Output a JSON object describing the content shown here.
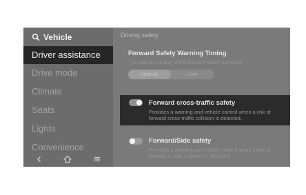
{
  "sidebar": {
    "header": "Vehicle",
    "items": [
      {
        "label": "Driver assistance"
      },
      {
        "label": "Drive mode"
      },
      {
        "label": "Climate"
      },
      {
        "label": "Seats"
      },
      {
        "label": "Lights"
      },
      {
        "label": "Convenience"
      }
    ],
    "nav_icons": [
      "back-icon",
      "home-icon",
      "menu-icon"
    ]
  },
  "main": {
    "section_title": "Driving safety",
    "warning_timing": {
      "title": "Forward Safety Warning Timing",
      "description": "The warning timing of the forward safety functions",
      "options": [
        "Normal",
        "Late"
      ],
      "selected": "Normal"
    },
    "cross_traffic": {
      "title": "Forward cross-traffic safety",
      "description_lines": [
        "Provides a warning and vehicle control when a risk of",
        "forward cross-traffic collision is detected."
      ],
      "enabled": true
    },
    "side_safety": {
      "title": "Forward/Side safety",
      "description_lines": [
        "Provides a warning and vehicle control when a risk of",
        "forward or side collision is detected."
      ],
      "enabled": false
    }
  },
  "colors": {
    "screen_bg": "#7a7a7a",
    "active_item_bg": "#262626",
    "highlight_card_bg": "#2b2b2b"
  }
}
